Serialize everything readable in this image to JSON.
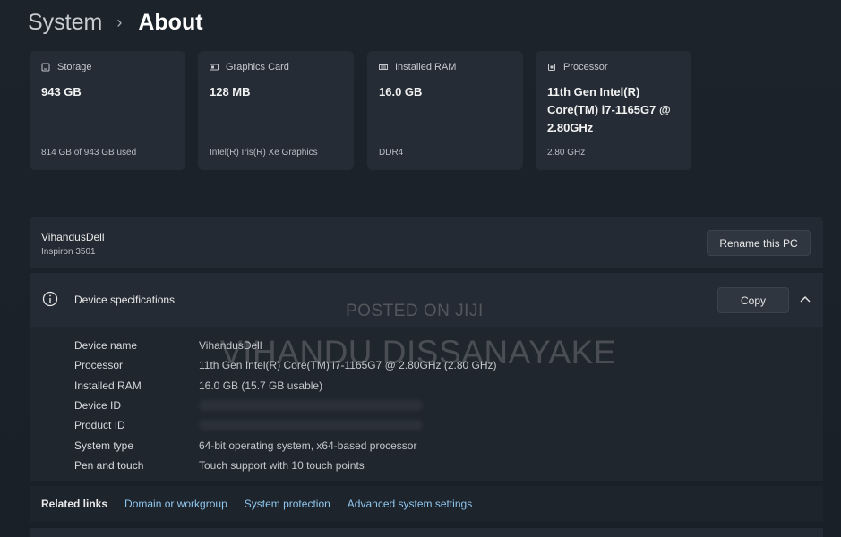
{
  "breadcrumb": {
    "parent": "System",
    "separator": "›",
    "current": "About"
  },
  "cards": [
    {
      "icon": "storage-icon",
      "title": "Storage",
      "value": "943 GB",
      "sub": "814 GB of 943 GB used"
    },
    {
      "icon": "graphics-card-icon",
      "title": "Graphics Card",
      "value": "128 MB",
      "sub": "Intel(R) Iris(R) Xe Graphics"
    },
    {
      "icon": "ram-icon",
      "title": "Installed RAM",
      "value": "16.0 GB",
      "sub": "DDR4"
    },
    {
      "icon": "processor-icon",
      "title": "Processor",
      "value": "11th Gen Intel(R) Core(TM) i7-1165G7 @ 2.80GHz",
      "sub": "2.80 GHz"
    }
  ],
  "pc": {
    "name": "VihandusDell",
    "model": "Inspiron 3501",
    "rename_label": "Rename this PC"
  },
  "specs": {
    "title": "Device specifications",
    "copy_label": "Copy",
    "rows": [
      {
        "label": "Device name",
        "value": "VihandusDell"
      },
      {
        "label": "Processor",
        "value": "11th Gen Intel(R) Core(TM) i7-1165G7 @ 2.80GHz (2.80 GHz)"
      },
      {
        "label": "Installed RAM",
        "value": "16.0 GB (15.7 GB usable)"
      },
      {
        "label": "Device ID",
        "value": ""
      },
      {
        "label": "Product ID",
        "value": ""
      },
      {
        "label": "System type",
        "value": "64-bit operating system, x64-based processor"
      },
      {
        "label": "Pen and touch",
        "value": "Touch support with 10 touch points"
      }
    ]
  },
  "related": {
    "label": "Related links",
    "links": [
      "Domain or workgroup",
      "System protection",
      "Advanced system settings"
    ]
  },
  "watermark": {
    "line1": "POSTED ON JIJI",
    "line2": "VIHANDU DISSANAYAKE"
  },
  "colors": {
    "background": "#1c2128",
    "card": "#252c35",
    "link": "#8fc6ee"
  }
}
